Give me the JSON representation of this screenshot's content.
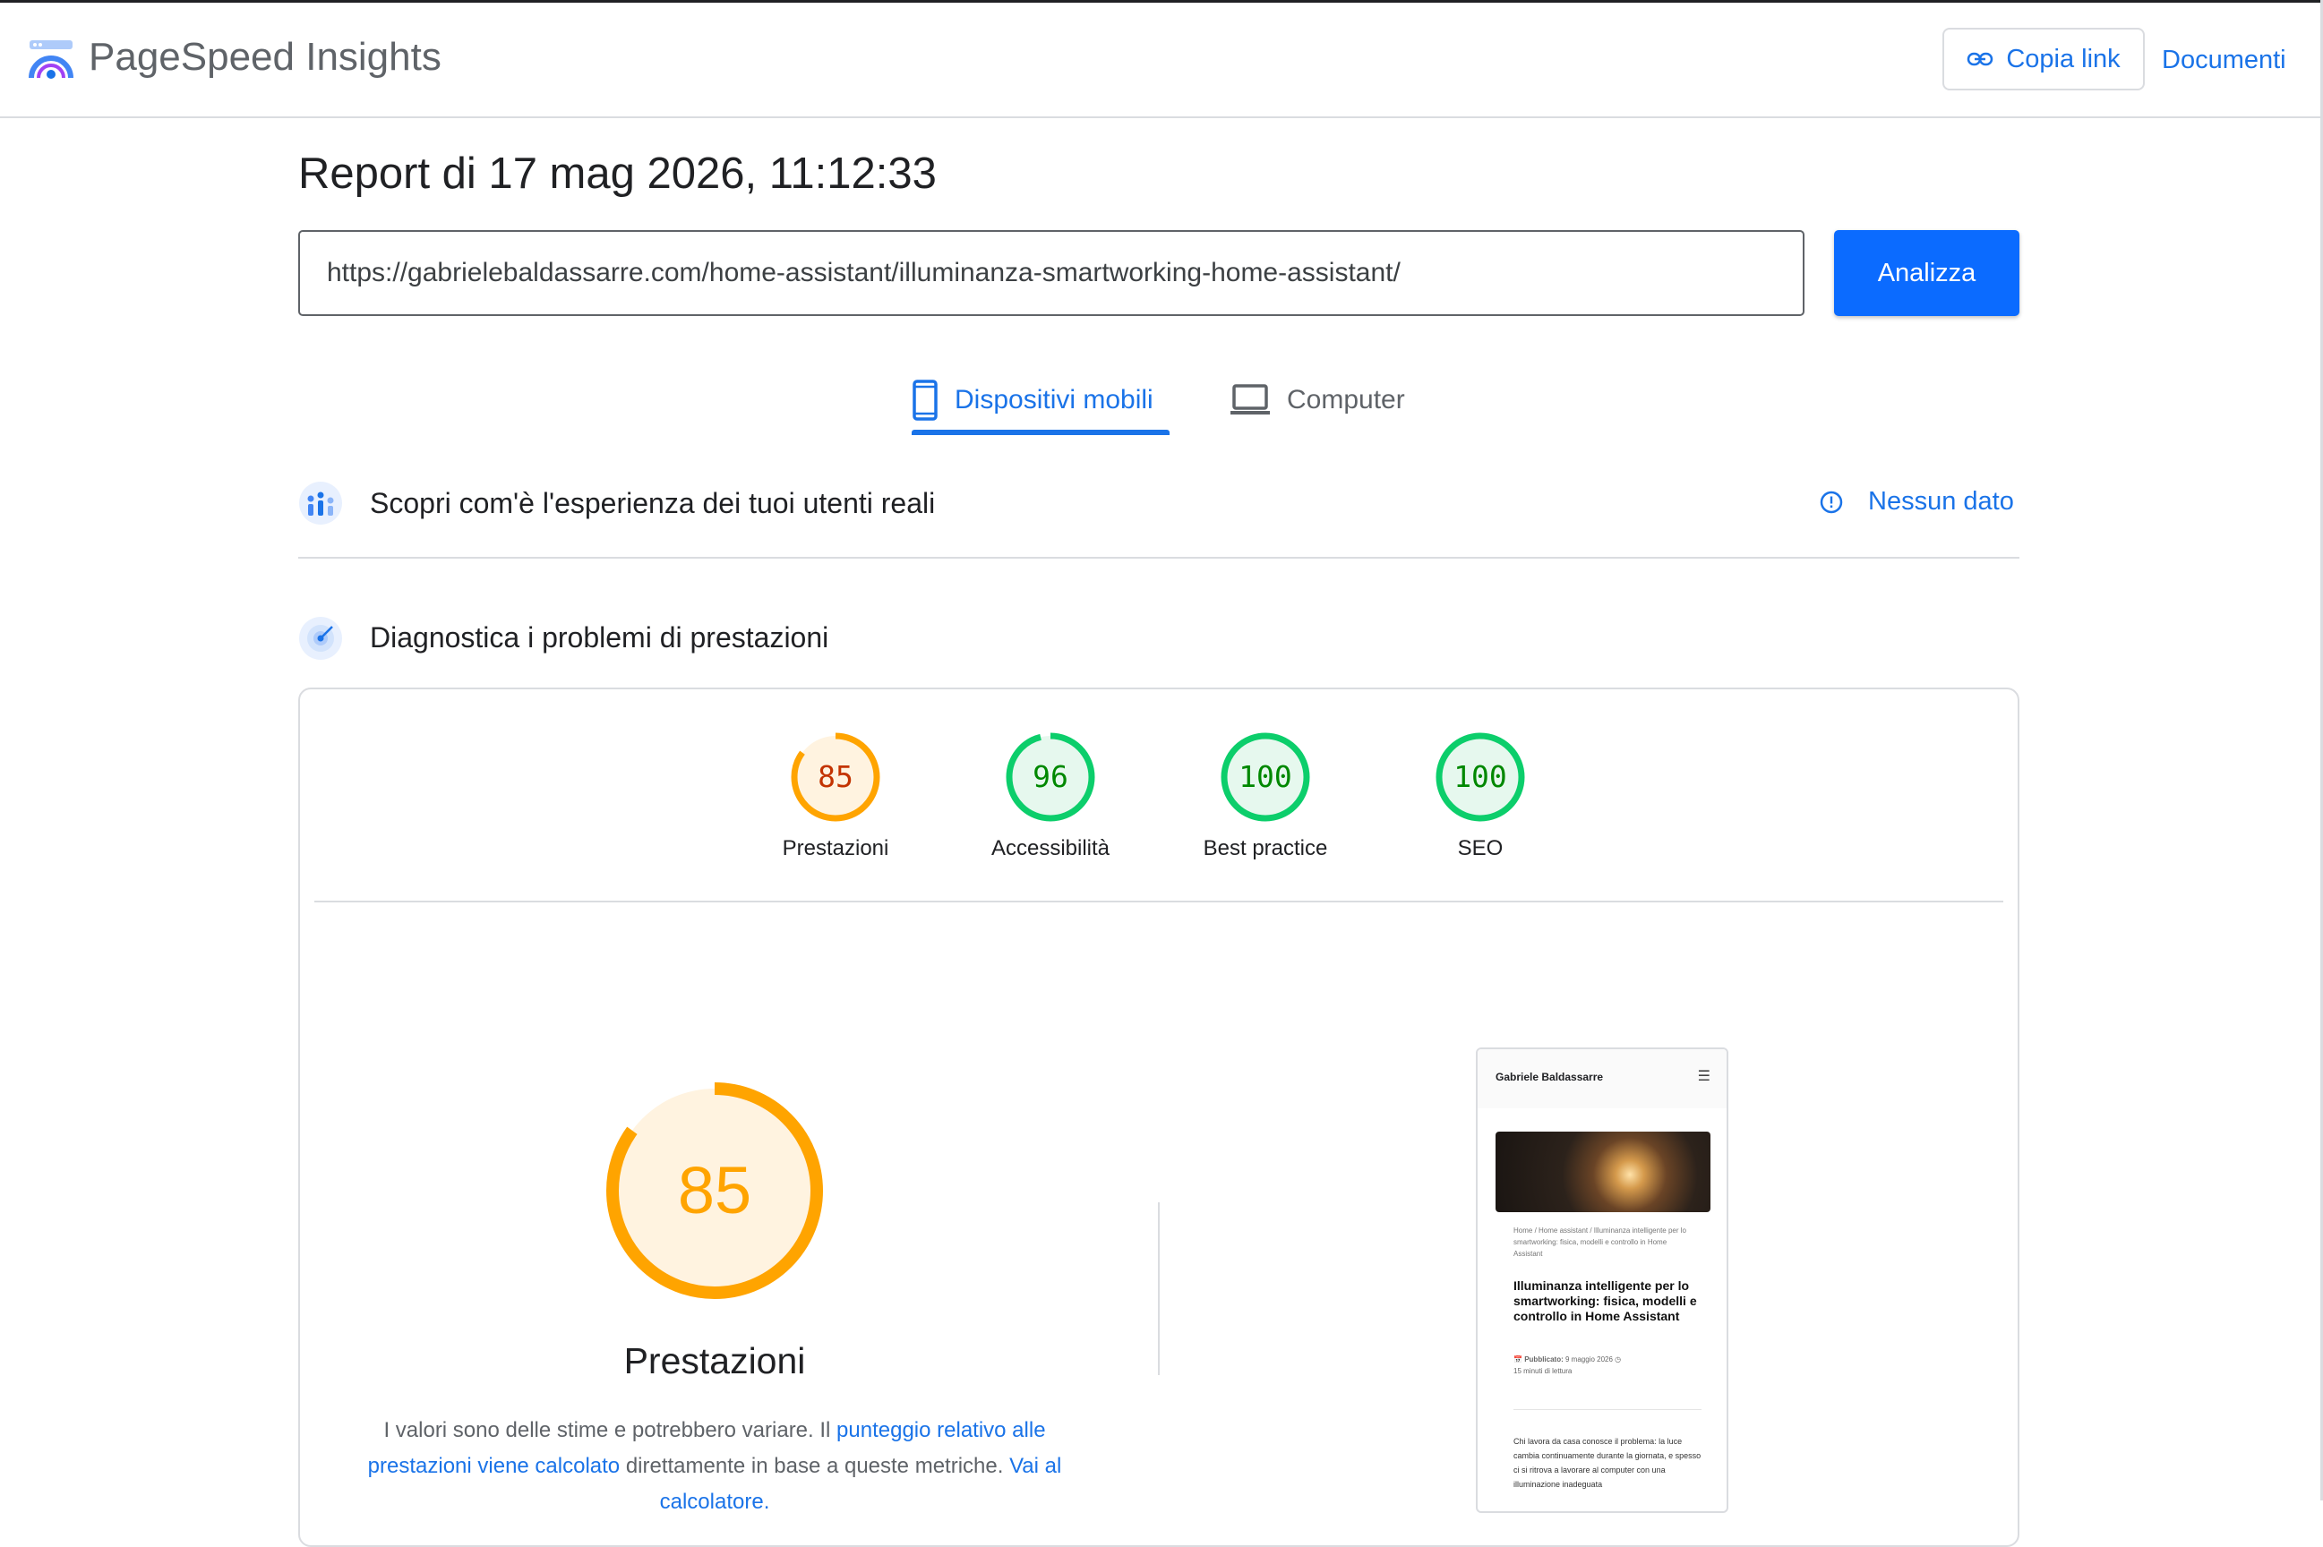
{
  "header": {
    "app_title": "PageSpeed Insights",
    "copy_link_label": "Copia link",
    "docs_label": "Documenti"
  },
  "report": {
    "title": "Report di 17 mag 2026, 11:12:33",
    "url_value": "https://gabrielebaldassarre.com/home-assistant/illuminanza-smartworking-home-assistant/",
    "analyze_label": "Analizza"
  },
  "tabs": [
    {
      "label": "Dispositivi mobili",
      "icon": "smartphone-icon",
      "selected": true
    },
    {
      "label": "Computer",
      "icon": "laptop-icon",
      "selected": false
    }
  ],
  "field_data": {
    "title": "Scopri com'è l'esperienza dei tuoi utenti reali",
    "status": "Nessun dato"
  },
  "diagnostics": {
    "title": "Diagnostica i problemi di prestazioni"
  },
  "scores": [
    {
      "label": "Prestazioni",
      "value": "85",
      "color": "#ffa400",
      "fill": "#fff3e0",
      "text_color": "#c33300",
      "fraction": 0.85
    },
    {
      "label": "Accessibilità",
      "value": "96",
      "color": "#0cce6b",
      "fill": "#e6f8ee",
      "text_color": "#008800",
      "fraction": 0.96
    },
    {
      "label": "Best practice",
      "value": "100",
      "color": "#0cce6b",
      "fill": "#e6f8ee",
      "text_color": "#008800",
      "fraction": 1.0
    },
    {
      "label": "SEO",
      "value": "100",
      "color": "#0cce6b",
      "fill": "#e6f8ee",
      "text_color": "#008800",
      "fraction": 1.0
    }
  ],
  "performance": {
    "score": "85",
    "fraction": 0.85,
    "label": "Prestazioni",
    "desc_part1": "I valori sono delle stime e potrebbero variare. Il ",
    "desc_link1": "punteggio relativo alle prestazioni viene calcolato",
    "desc_part2": " direttamente in base a queste metriche. ",
    "desc_link2": "Vai al calcolatore."
  },
  "screenshot": {
    "brand": "Gabriele Baldassarre",
    "breadcrumb": "Home / Home assistant / Illuminanza intelligente per lo smartworking: fisica, modelli e controllo in Home Assistant",
    "title": "Illuminanza intelligente per lo smartworking: fisica, modelli e controllo in Home Assistant",
    "published_label": "Pubblicato:",
    "published_date": "9 maggio 2026",
    "reading_time": "15 minuti di lettura",
    "body": "Chi lavora da casa conosce il problema: la luce cambia continuamente durante la giornata, e spesso ci si ritrova a lavorare al computer con una illuminazione inadeguata"
  },
  "colors": {
    "accent": "#1a73e8",
    "analyze_button": "#0b6bff",
    "average": "#ffa400",
    "pass": "#0cce6b"
  }
}
